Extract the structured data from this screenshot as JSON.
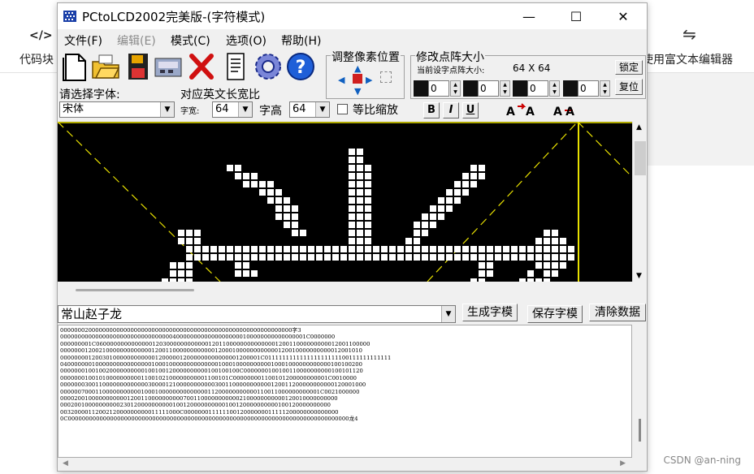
{
  "background_app": {
    "code_block_label": "代码块",
    "rich_text_label": "使用富文本编辑器"
  },
  "window": {
    "title": "PCtoLCD2002完美版-(字符模式)",
    "minimize": "—",
    "maximize": "☐",
    "close": "✕"
  },
  "menu": [
    "文件(F)",
    "编辑(E)",
    "模式(C)",
    "选项(O)",
    "帮助(H)"
  ],
  "toolbar_icons": [
    "new-file-icon",
    "open-folder-icon",
    "save-disk-icon",
    "scan-icon",
    "delete-x-icon",
    "notes-icon",
    "settings-gear-icon",
    "help-icon"
  ],
  "pixel_adjust": {
    "label": "调整像素位置"
  },
  "matrix_size": {
    "label": "修改点阵大小",
    "current_label": "当前设字点阵大小:",
    "current_value": "64  X  64",
    "lock_button": "锁定",
    "restore_button": "复位",
    "spinners": [
      "0",
      "0",
      "0",
      "0"
    ]
  },
  "font": {
    "select_label": "请选择字体:",
    "selected": "宋体",
    "ratio_label": "对应英文长宽比",
    "width_label": "字宽:",
    "width_value": "64",
    "height_label": "字高",
    "height_value": "64",
    "scale_label": "等比缩放",
    "scale_checked": false
  },
  "format_buttons": [
    "B",
    "I",
    "U"
  ],
  "text_input": {
    "value": "常山赵子龙",
    "generate_button": "生成字模",
    "save_button": "保存字模",
    "clear_button": "清除数据"
  },
  "output_lines": [
    "000000020000000000000000000000000000000000000000000000000000000000字3",
    "0000000000000000000000000000000040000000000000000000100000000000000001C0000000",
    "000000001C060000000000000012030000000000001201100000000000000120011000000000012001100000",
    "00000001200210000000000000120011000000000000120001000000000000120010000000000012001010",
    "000000001200301000000000000120000012000000000000001200001C011111111111111111111100111111111111",
    "04000000010000000000000000100010000000000000010001000000000010001000000000000100100200",
    "000000010010020000000000100100120000000000100100100C0000000100100110000000000100101120",
    "000000010010100000000001100102100000000001100101C000000001100101200000000001C0010000",
    "000000030011000000000000030000121000000000003001100000000000120011200000000000120001000",
    "00000070001100000000000100010000000000000011200000000000110011000000000001C0021000000",
    "0000200100000000000120011000000000070011000000000002100000000000120010000000000",
    "00020010000000000230120000000000100120000000000100120000000000100120000000000",
    "0032000011200212000000000011111000C00000001111110012000000011111200000000000000",
    "0C00000000000000000000000000000000000000000000000000000000000000000000000000000000龙4"
  ],
  "watermark": "CSDN @an-ning"
}
